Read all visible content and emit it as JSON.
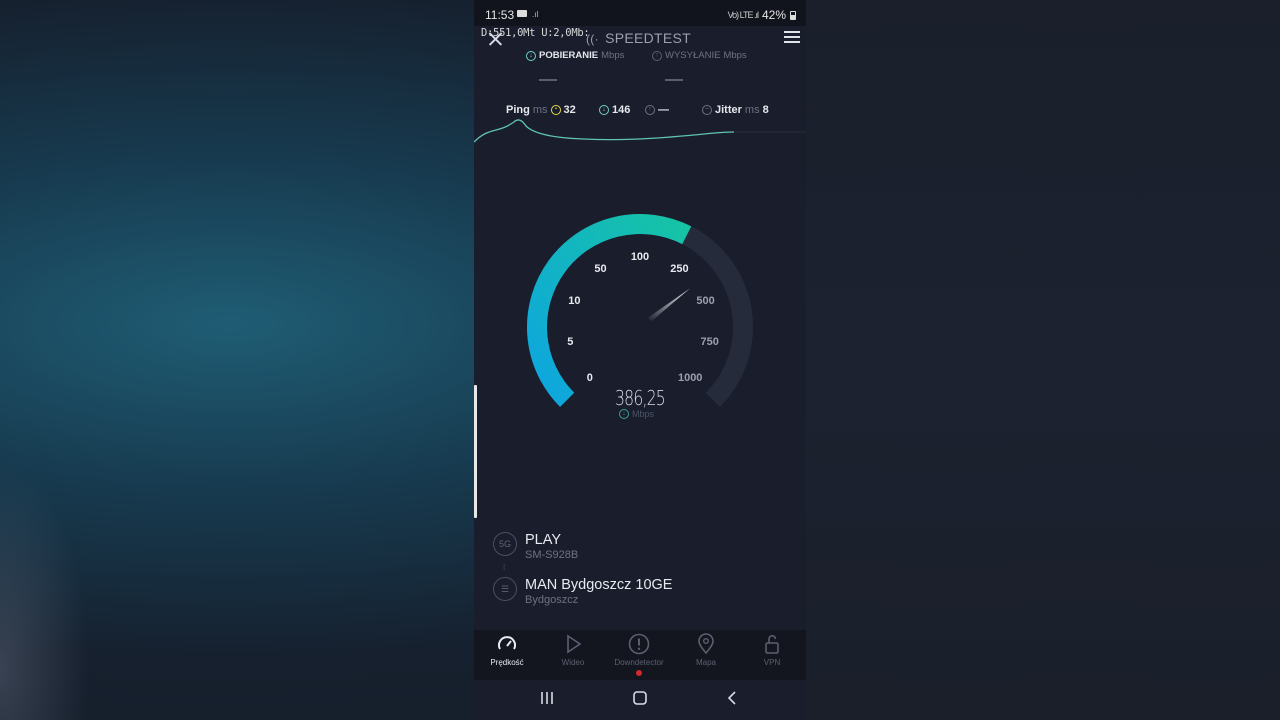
{
  "status_bar": {
    "time": "11:53",
    "network_small": ".ıl",
    "battery": "42%",
    "right_icons_text": "Vo) LTE .ıl"
  },
  "overlay": {
    "speed_text": "D:551,0Mt U:2,0Mb:"
  },
  "header": {
    "title": "SPEEDTEST",
    "logo": "((·"
  },
  "tabs": [
    {
      "label": "POBIERANIE",
      "unit": "Mbps",
      "active": true
    },
    {
      "label": "WYSYŁANIE",
      "unit": "Mbps",
      "active": false
    }
  ],
  "metrics": {
    "ping_label": "Ping",
    "ping_unit": "ms",
    "ping_value": "32",
    "download_value": "146",
    "upload_value": "—",
    "jitter_label": "Jitter",
    "jitter_unit": "ms",
    "jitter_value": "8"
  },
  "gauge": {
    "tick_labels": [
      "0",
      "5",
      "10",
      "50",
      "100",
      "250",
      "500",
      "750",
      "1000"
    ],
    "value": "386,25",
    "unit": "Mbps",
    "accent_start": "#0ea5e0",
    "accent_end": "#16c4a4"
  },
  "server": {
    "carrier": "PLAY",
    "device": "SM-S928B",
    "network_badge": "5G",
    "host": "MAN Bydgoszcz 10GE",
    "location": "Bydgoszcz"
  },
  "bottom_nav": [
    {
      "label": "Prędkość",
      "icon": "speedometer-icon",
      "active": true
    },
    {
      "label": "Wideo",
      "icon": "play-icon",
      "active": false
    },
    {
      "label": "Downdetector",
      "icon": "alert-icon",
      "active": false
    },
    {
      "label": "Mapa",
      "icon": "map-pin-icon",
      "active": false
    },
    {
      "label": "VPN",
      "icon": "unlock-icon",
      "active": false
    }
  ]
}
